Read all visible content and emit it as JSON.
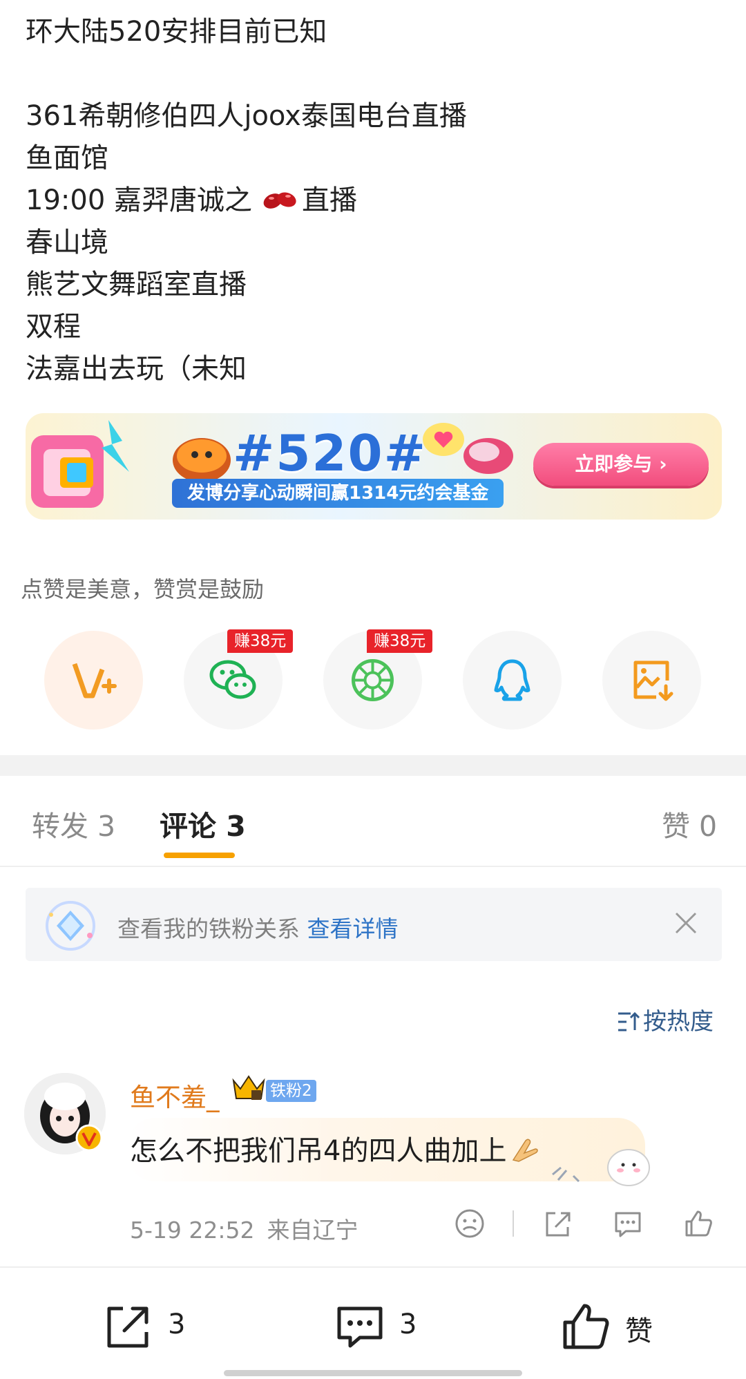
{
  "post": {
    "lines": [
      "环大陆520安排目前已知",
      "",
      "361希朝修伯四人joox泰国电台直播",
      "鱼面馆",
      "19:00 嘉羿唐诚之",
      "春山境",
      "熊艺文舞蹈室直播",
      "双程",
      "法嘉出去玩（未知"
    ],
    "line5_suffix": "直播"
  },
  "banner": {
    "tag": "#520#",
    "subtitle": "发博分享心动瞬间赢1314元约会基金",
    "button": "立即参与 ›"
  },
  "like_hint": "点赞是美意，赞赏是鼓励",
  "share": {
    "items": [
      {
        "icon": "v-plus-icon"
      },
      {
        "icon": "wechat-icon",
        "badge": "赚38元"
      },
      {
        "icon": "moments-icon",
        "badge": "赚38元"
      },
      {
        "icon": "qq-icon"
      },
      {
        "icon": "save-image-icon"
      }
    ]
  },
  "tabs": {
    "repost": "转发 3",
    "comments": "评论 3",
    "likes": "赞 0"
  },
  "notice": {
    "text": "查看我的铁粉关系 ",
    "link": "查看详情"
  },
  "sort_label": "按热度",
  "comment": {
    "username": "鱼不羞_",
    "fan_badge": "铁粉2",
    "text": "怎么不把我们吊4的四人曲加上",
    "time": "5-19 22:52",
    "location": "来自辽宁"
  },
  "bottom_bar": {
    "repost_count": "3",
    "comment_count": "3",
    "like_label": "赞"
  },
  "colors": {
    "accent_orange": "#f7a100",
    "link_blue": "#2d73c6",
    "badge_red": "#e8232a",
    "username_orange": "#e07a1c"
  }
}
